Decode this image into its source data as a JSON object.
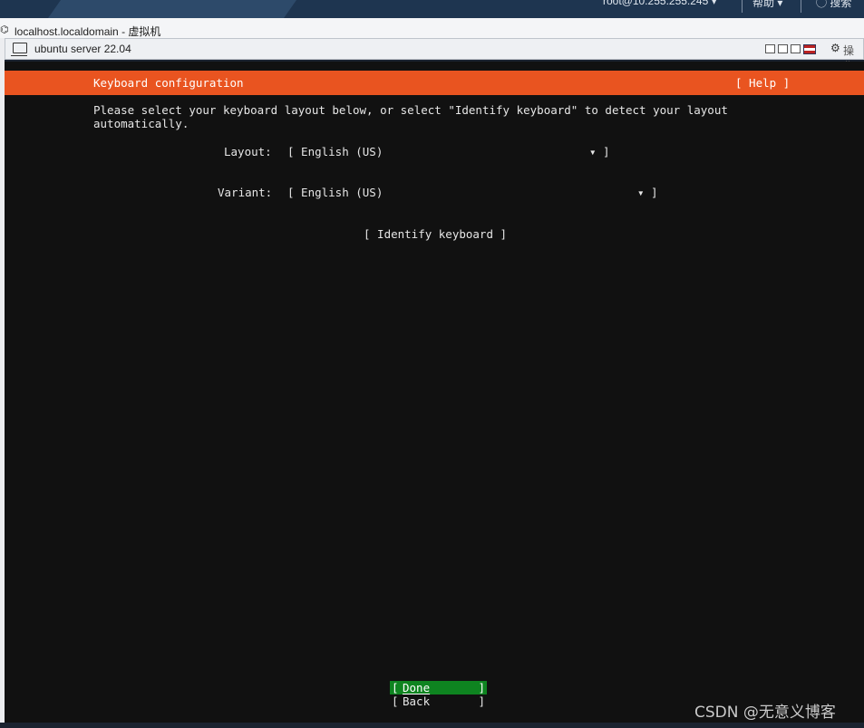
{
  "topbar": {
    "user": "root@10.255.255.245 ▾",
    "help": "帮助 ▾",
    "search": "◯ 搜索"
  },
  "host": {
    "title": "localhost.localdomain - 虚拟机"
  },
  "console": {
    "vm_name": "ubuntu server 22.04",
    "actions_label": "操作"
  },
  "installer": {
    "header_title": "Keyboard configuration",
    "help_label": "[ Help ]",
    "instructions": "Please select your keyboard layout below, or select \"Identify keyboard\" to detect your layout\nautomatically.",
    "layout": {
      "label": "Layout:",
      "value": "[ English (US)",
      "arrow": "▾ ]"
    },
    "variant": {
      "label": "Variant:",
      "value": "[ English (US)",
      "arrow": "▾ ]"
    },
    "identify_label": "[ Identify keyboard ]",
    "buttons": {
      "bracket_open": "[",
      "bracket_close": "]",
      "done": "Done",
      "back": "Back"
    }
  },
  "watermark": "CSDN @无意义博客",
  "colors": {
    "ubuntu_orange": "#e95420",
    "done_green": "#0e8420",
    "terminal_bg": "#111111"
  }
}
